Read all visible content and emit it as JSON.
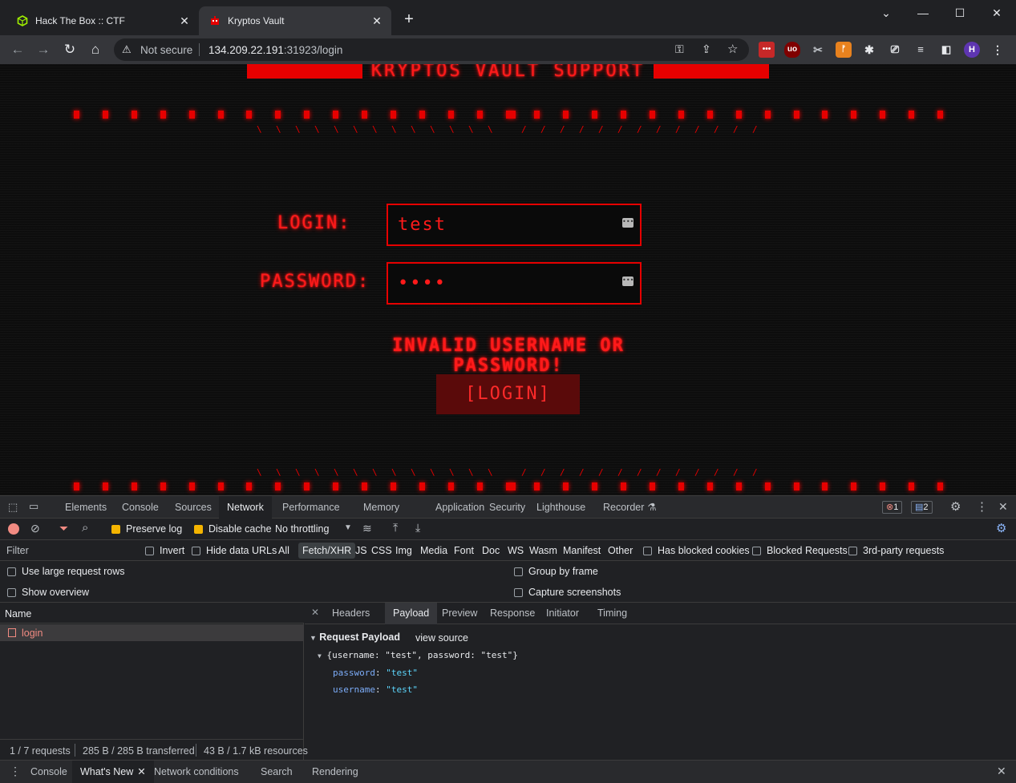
{
  "tabs": [
    {
      "title": "Hack The Box :: CTF",
      "active": false
    },
    {
      "title": "Kryptos Vault",
      "active": true
    }
  ],
  "window_controls": {
    "minimize": "—",
    "maximize": "☐",
    "close": "✕",
    "tablist": "⌄",
    "new_tab": "+"
  },
  "address": {
    "security_label": "Not secure",
    "host": "134.209.22.191",
    "path": ":31923/login"
  },
  "page": {
    "header": "KRYPTOS VAULT SUPPORT",
    "login_label": "LOGIN:",
    "password_label": "PASSWORD:",
    "login_value": "test",
    "password_value": "••••",
    "error": "INVALID USERNAME OR PASSWORD!",
    "submit": "[LOGIN]",
    "accent_color": "#e60000"
  },
  "devtools": {
    "panels": [
      "Elements",
      "Console",
      "Sources",
      "Network",
      "Performance",
      "Memory",
      "Application",
      "Security",
      "Lighthouse",
      "Recorder"
    ],
    "selected_panel": "Network",
    "errors_count": "1",
    "messages_count": "2",
    "toolbar": {
      "preserve_log": "Preserve log",
      "disable_cache": "Disable cache",
      "throttling": "No throttling"
    },
    "filter": {
      "placeholder": "Filter",
      "invert": "Invert",
      "hide_data_urls": "Hide data URLs",
      "types": [
        "All",
        "Fetch/XHR",
        "JS",
        "CSS",
        "Img",
        "Media",
        "Font",
        "Doc",
        "WS",
        "Wasm",
        "Manifest",
        "Other"
      ],
      "selected_type": "Fetch/XHR",
      "has_blocked_cookies": "Has blocked cookies",
      "blocked_requests": "Blocked Requests",
      "third_party": "3rd-party requests"
    },
    "options": {
      "large_rows": "Use large request rows",
      "show_overview": "Show overview",
      "group_by_frame": "Group by frame",
      "capture_screenshots": "Capture screenshots"
    },
    "name_header": "Name",
    "requests": [
      {
        "name": "login",
        "status": "failed"
      }
    ],
    "status_bar": {
      "requests": "1 / 7 requests",
      "transferred": "285 B / 285 B transferred",
      "resources": "43 B / 1.7 kB resources"
    },
    "detail_tabs": [
      "Headers",
      "Payload",
      "Preview",
      "Response",
      "Initiator",
      "Timing"
    ],
    "selected_detail": "Payload",
    "payload": {
      "section": "Request Payload",
      "view_source": "view source",
      "summary": "{username: \"test\", password: \"test\"}",
      "fields": [
        {
          "key": "password",
          "value": "\"test\""
        },
        {
          "key": "username",
          "value": "\"test\""
        }
      ]
    },
    "drawer_tabs": [
      "Console",
      "What's New",
      "Network conditions",
      "Search",
      "Rendering"
    ],
    "selected_drawer": "What's New"
  }
}
